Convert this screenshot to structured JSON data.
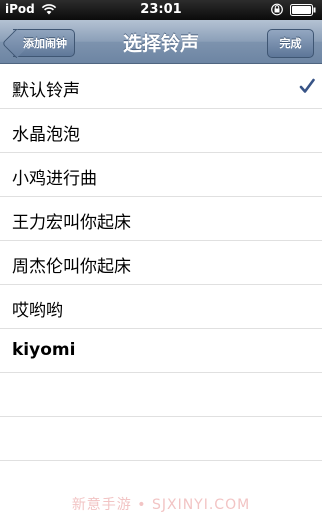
{
  "status_bar": {
    "carrier": "iPod",
    "time": "23:01",
    "wifi_icon": "wifi-icon",
    "lock_icon": "rotation-lock-icon",
    "battery_icon": "battery-icon"
  },
  "nav": {
    "title": "选择铃声",
    "back_label": "添加闹钟",
    "done_label": "完成"
  },
  "ringtones": [
    {
      "label": "默认铃声",
      "selected": true
    },
    {
      "label": "水晶泡泡",
      "selected": false
    },
    {
      "label": "小鸡进行曲",
      "selected": false
    },
    {
      "label": "王力宏叫你起床",
      "selected": false
    },
    {
      "label": "周杰伦叫你起床",
      "selected": false
    },
    {
      "label": "哎哟哟",
      "selected": false
    },
    {
      "label": "kiyomi",
      "selected": false
    }
  ],
  "colors": {
    "nav_bar": "#7d93ae",
    "checkmark": "#385487",
    "separator": "#e0e0e0"
  },
  "watermark": "新意手游 • SJXINYI.COM"
}
